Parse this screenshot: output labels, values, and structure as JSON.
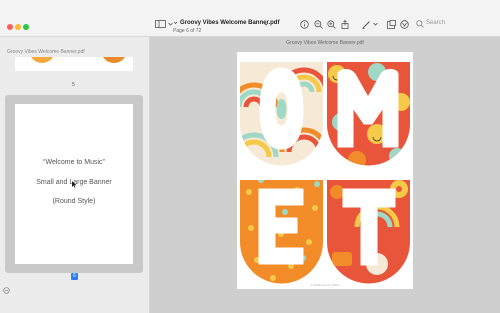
{
  "window": {
    "traffic_lights": {
      "close": "#ff5f57",
      "minimize": "#febc2e",
      "zoom": "#28c840"
    }
  },
  "toolbar": {
    "doc_title": "Groovy Vibes Welcome Banner.pdf",
    "page_info": "Page 6 of 72",
    "search_placeholder": "Search",
    "icons": [
      "sidebar-icon",
      "chevron-down-icon",
      "info-icon",
      "zoom-out-icon",
      "zoom-in-icon",
      "share-icon",
      "markup-icon",
      "window-icon",
      "annotate-icon",
      "search-icon"
    ]
  },
  "sidebar": {
    "title": "Groovy Vibes Welcome Banner.pdf",
    "thumb_prev_number": "5",
    "thumb_selected": {
      "lines": [
        "“Welcome to Music”",
        "Small and Large Banner",
        "(Round Style)"
      ],
      "number": "6"
    }
  },
  "main": {
    "title": "Groovy Vibes Welcome Banner.pdf",
    "letters": [
      "O",
      "M",
      "E",
      "T"
    ],
    "footer": "© 2023 Groovy Vibes"
  },
  "colors": {
    "accent": "#2f7cf6",
    "orange": "#f28c28",
    "red": "#e8553a",
    "yellow": "#f7c948",
    "mint": "#9fd8c4"
  }
}
